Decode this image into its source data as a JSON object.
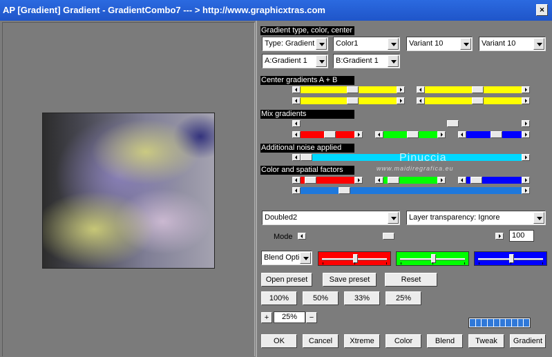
{
  "window": {
    "title": "AP [Gradient]  Gradient - GradientCombo7    --- > http://www.graphicxtras.com",
    "close": "×"
  },
  "sections": {
    "gradient_type": "Gradient type, color, center",
    "center": "Center gradients A + B",
    "mix": "Mix gradients",
    "noise": "Additional noise applied",
    "color_spatial": "Color and spatial factors"
  },
  "dropdowns": {
    "type": "Type: Gradient",
    "color": "Color1",
    "variant1": "Variant 10",
    "variant2": "Variant 10",
    "a_gradient": "A:Gradient 1",
    "b_gradient": "B:Gradient 1",
    "doubled": "Doubled2",
    "layer_transparency": "Layer transparency: Ignore",
    "blend": "Blend Optio"
  },
  "mode": {
    "label": "Mode",
    "value": "100"
  },
  "buttons": {
    "open_preset": "Open preset",
    "save_preset": "Save preset",
    "reset": "Reset",
    "zoom100": "100%",
    "zoom50": "50%",
    "zoom33": "33%",
    "zoom25": "25%",
    "zoom_in": "+",
    "zoom_out": "−",
    "ok": "OK",
    "cancel": "Cancel",
    "xtreme": "Xtreme",
    "color": "Color",
    "blend": "Blend",
    "tweak": "Tweak",
    "gradient": "Gradient"
  },
  "zoom_value": "25%",
  "watermark": {
    "main": "Pinuccia",
    "sub": "www.maidiregrafica.eu"
  },
  "sliders": {
    "center": [
      {
        "color": "#ffff00",
        "value": 0.55
      },
      {
        "color": "#ffff00",
        "value": 0.55
      },
      {
        "color": "#ffff00",
        "value": 0.55
      },
      {
        "color": "#ffff00",
        "value": 0.55
      }
    ],
    "mix": [
      {
        "color": "#7c7c7c",
        "value": 0.7
      },
      {
        "color": "#ff0000",
        "value": 0.55
      },
      {
        "color": "#00ff00",
        "value": 0.55
      },
      {
        "color": "#0000ff",
        "value": 0.55
      }
    ],
    "noise": {
      "color": "#00d8ff",
      "value": 0.0
    },
    "color_spatial": [
      {
        "color": "#ff0000",
        "value": 0.1
      },
      {
        "color": "#00ff00",
        "value": 0.1
      },
      {
        "color": "#0000ff",
        "value": 0.1
      },
      {
        "color": "#1e78dc",
        "value": 0.18
      }
    ],
    "mode": 0.43
  },
  "blend_sliders": [
    {
      "color": "#ff0000",
      "value": 0.5
    },
    {
      "color": "#00ff00",
      "value": 0.5
    },
    {
      "color": "#0000ff",
      "value": 0.5
    }
  ]
}
